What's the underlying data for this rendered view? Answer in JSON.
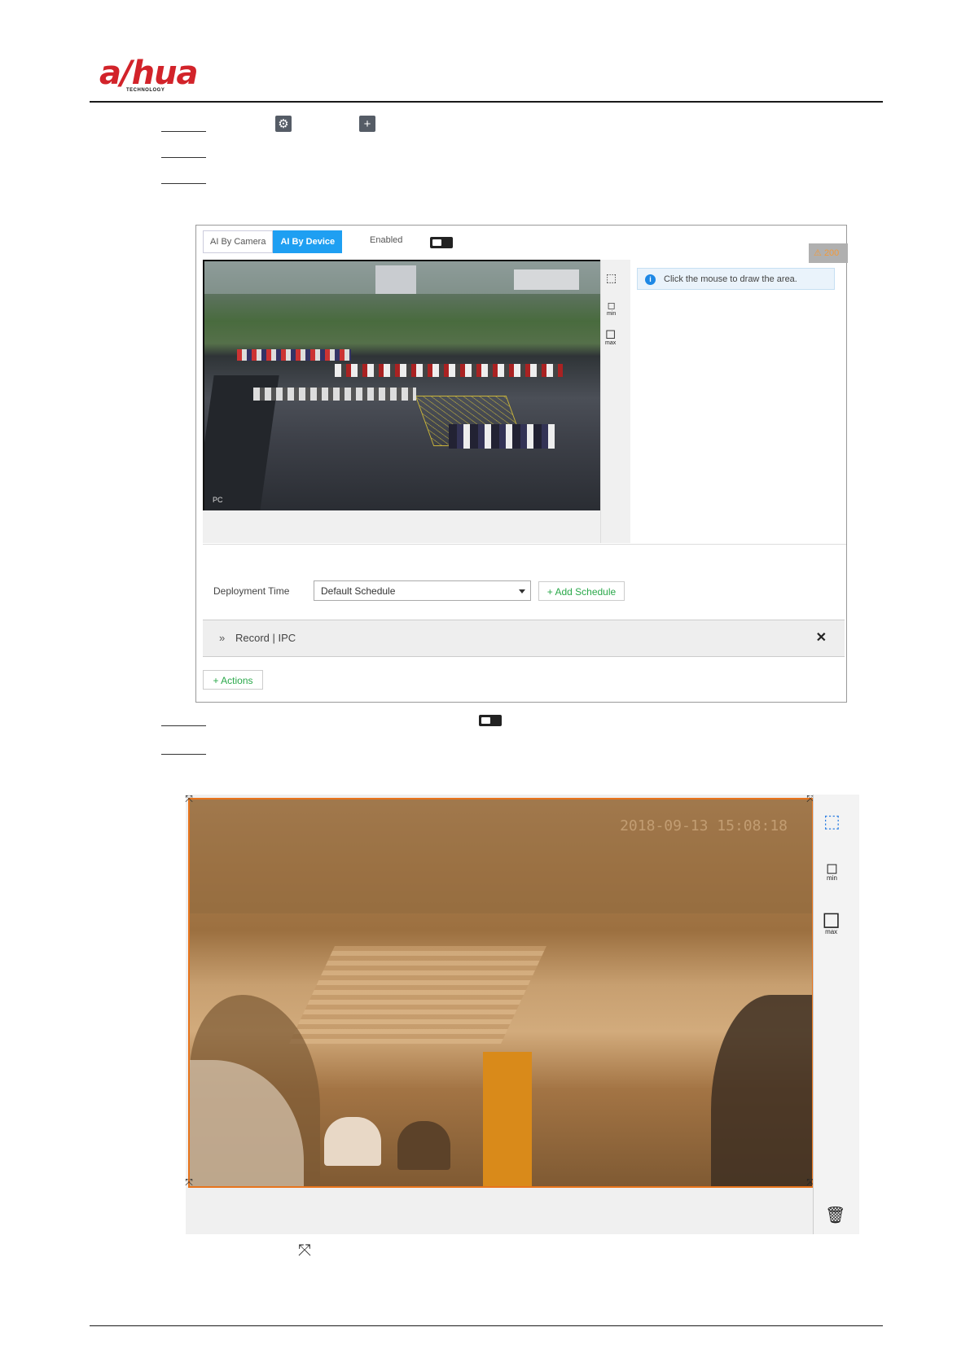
{
  "header": {
    "logo_text": "a/hua",
    "logo_sub": "TECHNOLOGY"
  },
  "toolbar_icons": {
    "gear": "gear-icon",
    "plus": "plus-icon"
  },
  "screenshot1": {
    "tabs": [
      {
        "label": "AI By Camera",
        "active": false
      },
      {
        "label": "AI By Device",
        "active": true
      }
    ],
    "enabled_label": "Enabled",
    "warning_badge": "200",
    "video_label": "PC",
    "info_text": "Click the mouse to draw the area.",
    "tools": [
      "min",
      "max"
    ],
    "deployment_label": "Deployment Time",
    "schedule_value": "Default Schedule",
    "add_schedule": "Add Schedule",
    "record_label": "Record | IPC",
    "actions_label": "Actions"
  },
  "screenshot2": {
    "timestamp": "2018-09-13 15:08:18",
    "tools": [
      "min",
      "max"
    ]
  },
  "colors": {
    "accent": "#1e9ff2",
    "green": "#2aa84a",
    "overlay": "#e8741c",
    "logo": "#d2232a"
  }
}
